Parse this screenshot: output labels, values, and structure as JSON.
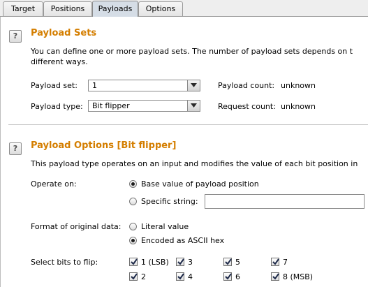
{
  "tabs": [
    {
      "label": "Target",
      "active": false
    },
    {
      "label": "Positions",
      "active": false
    },
    {
      "label": "Payloads",
      "active": true
    },
    {
      "label": "Options",
      "active": false
    }
  ],
  "payload_sets": {
    "help": "?",
    "title": "Payload Sets",
    "desc_line1": "You can define one or more payload sets. The number of payload sets depends on t",
    "desc_line2": "different ways.",
    "payload_set_label": "Payload set:",
    "payload_set_value": "1",
    "payload_type_label": "Payload type:",
    "payload_type_value": "Bit flipper",
    "payload_count_label": "Payload count:",
    "payload_count_value": "unknown",
    "request_count_label": "Request count:",
    "request_count_value": "unknown"
  },
  "payload_options": {
    "help": "?",
    "title": "Payload Options [Bit flipper]",
    "desc": "This payload type operates on an input and modifies the value of each bit position in",
    "operate_on_label": "Operate on:",
    "operate_base": "Base value of payload position",
    "operate_specific": "Specific string:",
    "operate_selected": "base",
    "specific_string_value": "",
    "format_label": "Format of original data:",
    "format_literal": "Literal value",
    "format_ascii_hex": "Encoded as ASCII hex",
    "format_selected": "ascii_hex",
    "bits_label": "Select bits to flip:",
    "bits": [
      {
        "label": "1 (LSB)",
        "checked": true
      },
      {
        "label": "2",
        "checked": true
      },
      {
        "label": "3",
        "checked": true
      },
      {
        "label": "4",
        "checked": true
      },
      {
        "label": "5",
        "checked": true
      },
      {
        "label": "6",
        "checked": true
      },
      {
        "label": "7",
        "checked": true
      },
      {
        "label": "8 (MSB)",
        "checked": true
      }
    ]
  },
  "colors": {
    "section_title": "#d47e00",
    "active_tab": "#d5dde6"
  }
}
